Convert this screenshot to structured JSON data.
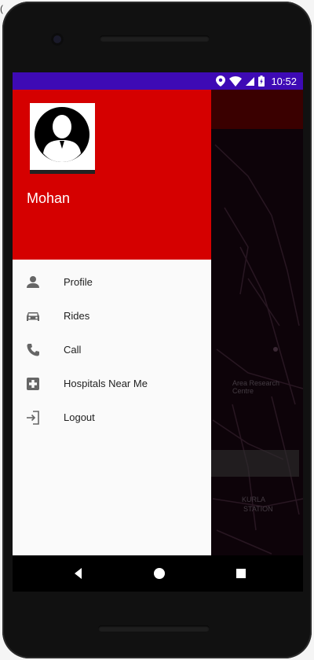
{
  "corner_mark": "(",
  "statusbar": {
    "time": "10:52",
    "icons": [
      "location-icon",
      "wifi-icon",
      "cellular-signal-icon",
      "battery-charging-icon"
    ]
  },
  "drawer": {
    "username": "Mohan",
    "avatar": "user-silhouette-icon",
    "items": [
      {
        "label": "Profile",
        "icon": "person-icon"
      },
      {
        "label": "Rides",
        "icon": "car-icon"
      },
      {
        "label": "Call",
        "icon": "phone-icon"
      },
      {
        "label": "Hospitals Near Me",
        "icon": "hospital-icon"
      },
      {
        "label": "Logout",
        "icon": "logout-icon"
      }
    ]
  },
  "map": {
    "labels": [
      "Area Research Centre",
      "KURLA",
      "STATION"
    ]
  },
  "navbar": {
    "buttons": [
      "back-icon",
      "home-icon",
      "recents-icon"
    ]
  },
  "colors": {
    "status_bar": "#3e0ab5",
    "drawer_header": "#d50000",
    "appbar": "#6a0000"
  }
}
